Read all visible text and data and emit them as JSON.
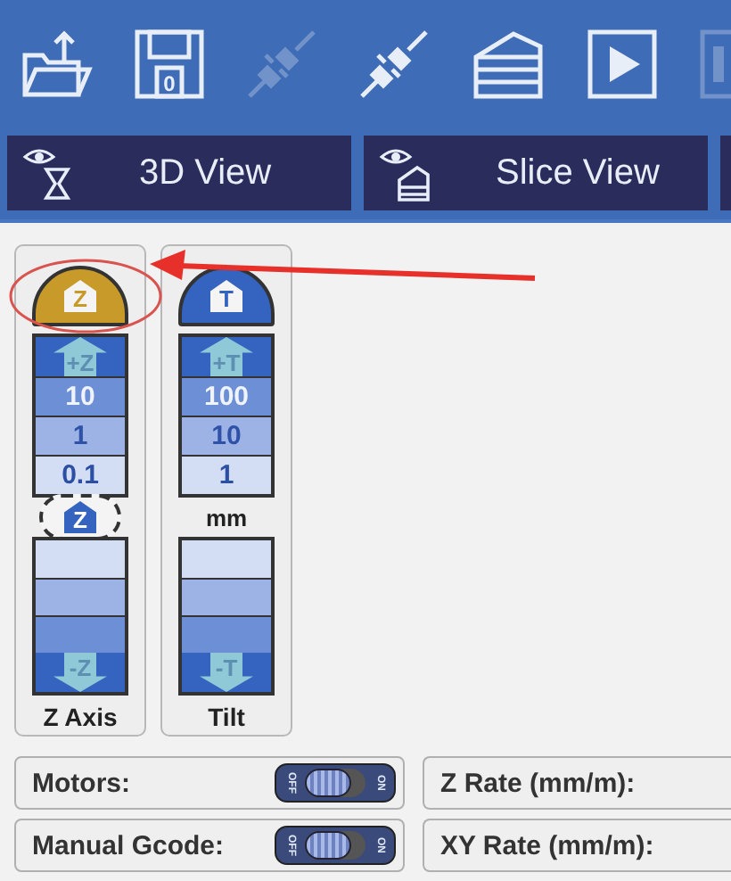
{
  "toolbar": [
    {
      "kind": "open",
      "disabled": false
    },
    {
      "kind": "save",
      "label": "0",
      "disabled": false
    },
    {
      "kind": "plug",
      "disabled": true
    },
    {
      "kind": "plug",
      "disabled": false
    },
    {
      "kind": "slice",
      "disabled": false
    },
    {
      "kind": "play",
      "disabled": false
    },
    {
      "kind": "partial",
      "disabled": true
    }
  ],
  "tabs": [
    {
      "label": "3D View",
      "kind": "hourglass"
    },
    {
      "label": "Slice View",
      "kind": "slice"
    }
  ],
  "axes": [
    {
      "label": "Z Axis",
      "home": "Z",
      "home_active": true,
      "up": "+Z",
      "steps": [
        "10",
        "1",
        "0.1"
      ],
      "badge": "Z",
      "down": "-Z"
    },
    {
      "label": "Tilt",
      "home": "T",
      "home_active": false,
      "up": "+T",
      "steps": [
        "100",
        "10",
        "1"
      ],
      "unit": "mm",
      "down": "-T"
    }
  ],
  "switches": [
    {
      "label": "Motors:",
      "on": false,
      "off_text": "OFF",
      "on_text": "ON"
    },
    {
      "label": "Manual Gcode:",
      "on": false,
      "off_text": "OFF",
      "on_text": "ON"
    }
  ],
  "rates": [
    {
      "label": "Z Rate (mm/m):"
    },
    {
      "label": "XY Rate (mm/m):"
    }
  ]
}
